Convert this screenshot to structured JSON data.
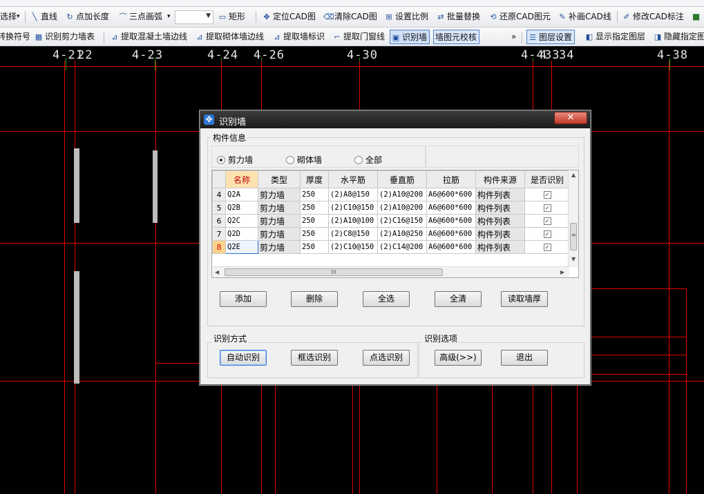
{
  "toolbar_top": {
    "items": [
      "直线",
      "点加长度",
      "三点画弧",
      "矩形",
      "定位CAD图",
      "清除CAD图",
      "设置比例",
      "批量替换",
      "还原CAD图元",
      "补画CAD线",
      "修改CAD标注"
    ],
    "first_partial": "选择"
  },
  "toolbar_second": {
    "items": [
      "转换符号",
      "识别剪力墙表",
      "提取混凝土墙边线",
      "提取砌体墙边线",
      "提取墙标识",
      "提取门窗线",
      "识别墙",
      "墙图元校核",
      "图层设置",
      "显示指定图层",
      "隐藏指定图层"
    ],
    "overflow": "»"
  },
  "axis_labels": [
    "4-21",
    "22",
    "4-23",
    "4-24",
    "4-26",
    "4-30",
    "4-4",
    "4",
    "33",
    "34",
    "4-38"
  ],
  "dialog": {
    "title": "识别墙",
    "close": "✕",
    "group_component": "构件信息",
    "radios": [
      {
        "label": "剪力墙",
        "checked": true
      },
      {
        "label": "砌体墙",
        "checked": false
      },
      {
        "label": "全部",
        "checked": false
      }
    ],
    "table": {
      "headers": [
        "名称",
        "类型",
        "厚度",
        "水平筋",
        "垂直筋",
        "拉筋",
        "构件来源",
        "是否识别"
      ],
      "rows": [
        {
          "no": "4",
          "name": "Q2A",
          "type": "剪力墙",
          "thickness": "250",
          "horizontal": "(2)A8@150",
          "vertical": "(2)A10@200",
          "tie": "A6@600*600",
          "source": "构件列表",
          "recognize": true
        },
        {
          "no": "5",
          "name": "Q2B",
          "type": "剪力墙",
          "thickness": "250",
          "horizontal": "(2)C10@150",
          "vertical": "(2)A10@200",
          "tie": "A6@600*600",
          "source": "构件列表",
          "recognize": true
        },
        {
          "no": "6",
          "name": "Q2C",
          "type": "剪力墙",
          "thickness": "250",
          "horizontal": "(2)A10@100",
          "vertical": "(2)C16@150",
          "tie": "A6@600*600",
          "source": "构件列表",
          "recognize": true
        },
        {
          "no": "7",
          "name": "Q2D",
          "type": "剪力墙",
          "thickness": "250",
          "horizontal": "(2)C8@150",
          "vertical": "(2)A10@250",
          "tie": "A6@600*600",
          "source": "构件列表",
          "recognize": true
        },
        {
          "no": "8",
          "name": "Q2E",
          "type": "剪力墙",
          "thickness": "250",
          "horizontal": "(2)C10@150",
          "vertical": "(2)C14@200",
          "tie": "A6@600*600",
          "source": "构件列表",
          "recognize": true
        }
      ],
      "hscroll_label": "III",
      "vscroll_label": "≡"
    },
    "buttons": {
      "add": "添加",
      "delete": "删除",
      "select_all": "全选",
      "clear_all": "全清",
      "read_thickness": "读取墙厚"
    },
    "group_method": "识别方式",
    "method_buttons": {
      "auto": "自动识别",
      "box": "框选识别",
      "point": "点选识别"
    },
    "group_options": "识别选项",
    "option_buttons": {
      "advanced": "高级(>>)",
      "exit": "退出"
    }
  }
}
